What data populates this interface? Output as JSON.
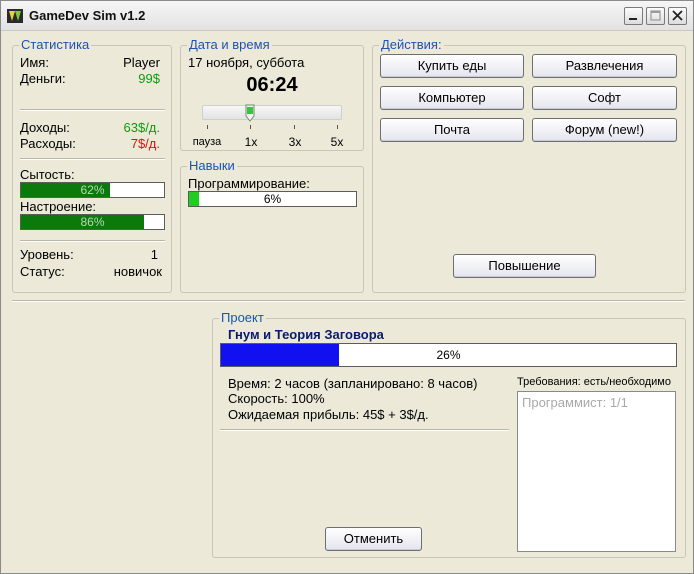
{
  "window": {
    "title": "GameDev Sim v1.2"
  },
  "stats": {
    "title": "Статистика",
    "name_label": "Имя:",
    "name_value": "Player",
    "money_label": "Деньги:",
    "money_value": "99$",
    "income_label": "Доходы:",
    "income_value": "63$/д.",
    "expense_label": "Расходы:",
    "expense_value": "7$/д.",
    "satiety_label": "Сытость:",
    "satiety_value": "62%",
    "satiety_fraction": 0.62,
    "mood_label": "Настроение:",
    "mood_value": "86%",
    "mood_fraction": 0.86,
    "level_label": "Уровень:",
    "level_value": "1",
    "status_label": "Статус:",
    "status_value": "новичок"
  },
  "datetime": {
    "title": "Дата и время",
    "date": "17 ноября, суббота",
    "time": "06:24",
    "speed_labels": [
      "пауза",
      "1x",
      "3x",
      "5x"
    ],
    "speed_selected": "1x"
  },
  "skills": {
    "title": "Навыки",
    "programming_label": "Программирование:",
    "programming_value": "6%",
    "programming_fraction": 0.06
  },
  "actions": {
    "title": "Действия:",
    "buy_food": "Купить еды",
    "entertainment": "Развлечения",
    "computer": "Компьютер",
    "software": "Софт",
    "mail": "Почта",
    "forum": "Форум (new!)",
    "promotion": "Повышение"
  },
  "project": {
    "title": "Проект",
    "name": "Гнум и Теория Заговора",
    "progress_value": "26%",
    "progress_fraction": 0.26,
    "time_text": "Время: 2 часов (запланировано: 8 часов)",
    "speed_text": "Скорость: 100%",
    "profit_text": "Ожидаемая прибыль:  45$ + 3$/д.",
    "requirements_title": "Требования: есть/необходимо",
    "requirements": [
      "Программист: 1/1"
    ],
    "cancel": "Отменить"
  },
  "colors": {
    "group_title": "#1c53b5",
    "positive": "#0a9e0a",
    "negative": "#e01010",
    "bar_green": "#0b7a0b",
    "skill_green": "#22cc22",
    "project_blue": "#1010f0"
  }
}
